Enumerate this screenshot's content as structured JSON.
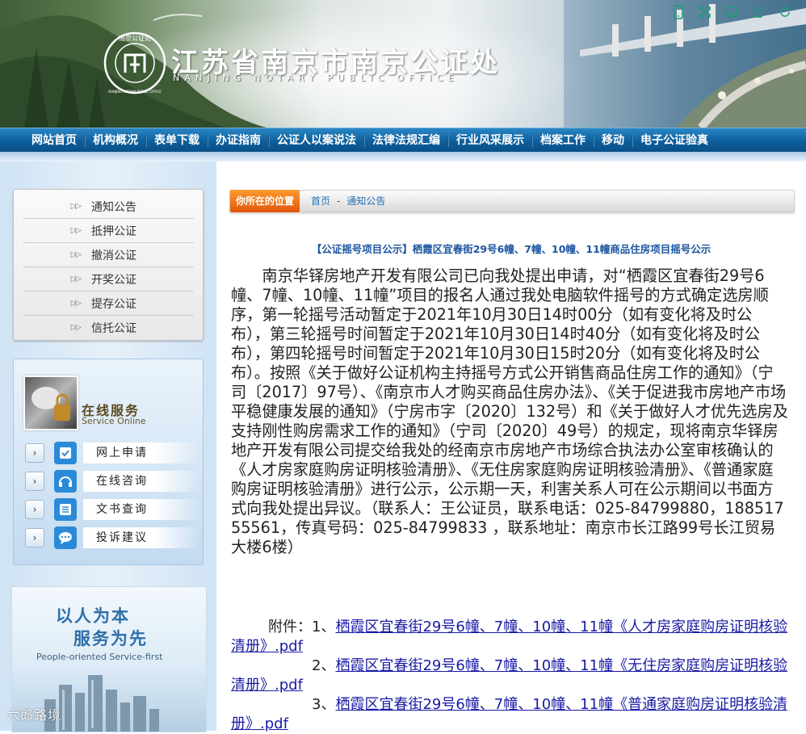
{
  "header": {
    "title_cn": "江苏省南京市南京公证处",
    "title_en": "NANJING NOTARY PUBLIC OFFICE",
    "seal_top": "南京公证处",
    "seal_ring": "NANJING NOTARY PUBLIC OFFICE",
    "tools": [
      "mobile-icon",
      "fullscreen-icon",
      "save-icon",
      "share-icon",
      "refresh-icon"
    ]
  },
  "nav": [
    "网站首页",
    "机构概况",
    "表单下载",
    "办证指南",
    "公证人以案说法",
    "法律法规汇编",
    "行业风采展示",
    "档案工作",
    "移动",
    "电子公证验真"
  ],
  "sidebar": {
    "notices": [
      "通知公告",
      "抵押公证",
      "撤消公证",
      "开奖公证",
      "提存公证",
      "信托公证"
    ],
    "service": {
      "title": "在线服务",
      "subtitle": "Service Online",
      "items": [
        {
          "label": "网上申请",
          "icon": "form-icon"
        },
        {
          "label": "在线咨询",
          "icon": "headset-icon"
        },
        {
          "label": "文书查询",
          "icon": "list-icon"
        },
        {
          "label": "投诉建议",
          "icon": "chat-icon"
        }
      ]
    },
    "slogan": {
      "line1": "以人为本",
      "line2": "服务为先",
      "en": "People-oriented  Service-first"
    },
    "watermark": "六郎路境"
  },
  "main": {
    "location_label": "你所在的位置",
    "breadcrumb": [
      "首页",
      "-",
      "通知公告"
    ],
    "title": "【公证摇号项目公示】栖霞区宜春街29号6幢、7幢、10幢、11幢商品住房项目摇号公示",
    "body": "南京华铎房地产开发有限公司已向我处提出申请，对“栖霞区宜春街29号6幢、7幢、10幢、11幢”项目的报名人通过我处电脑软件摇号的方式确定选房顺序，第一轮摇号活动暂定于2021年10月30日14时00分（如有变化将及时公布），第三轮摇号时间暂定于2021年10月30日14时40分（如有变化将及时公布），第四轮摇号时间暂定于2021年10月30日15时20分（如有变化将及时公布）。按照《关于做好公证机构主持摇号方式公开销售商品住房工作的通知》（宁司〔2017〕97号）、《南京市人才购买商品住房办法》、《关于促进我市房地产市场平稳健康发展的通知》（宁房市字〔2020〕132号）和《关于做好人才优先选房及支持刚性购房需求工作的通知》（宁司〔2020〕49号）的规定，现将南京华铎房地产开发有限公司提交给我处的经南京市房地产市场综合执法办公室审核确认的《人才房家庭购房证明核验清册》、《无住房家庭购房证明核验清册》、《普通家庭购房证明核验清册》进行公示，公示期一天，利害关系人可在公示期间以书面方式向我处提出异议。（联系人：王公证员，联系电话：025-84799880，18851755561，传真号码：025-84799833 ，联系地址：南京市长江路99号长江贸易大楼6楼）",
    "attachments_prefix": "附件：",
    "attachments": [
      {
        "num": "1、",
        "text": "栖霞区宜春街29号6幢、7幢、10幢、11幢《人才房家庭购房证明核验清册》.pdf"
      },
      {
        "num": "2、",
        "text": "栖霞区宜春街29号6幢、7幢、10幢、11幢《无住房家庭购房证明核验清册》.pdf"
      },
      {
        "num": "3、",
        "text": "栖霞区宜春街29号6幢、7幢、10幢、11幢《普通家庭购房证明核验清册》.pdf"
      }
    ]
  },
  "colors": {
    "nav": "#0d5f9c",
    "accent": "#e0560a",
    "link": "#1a1aa6",
    "title": "#1b55a0"
  }
}
